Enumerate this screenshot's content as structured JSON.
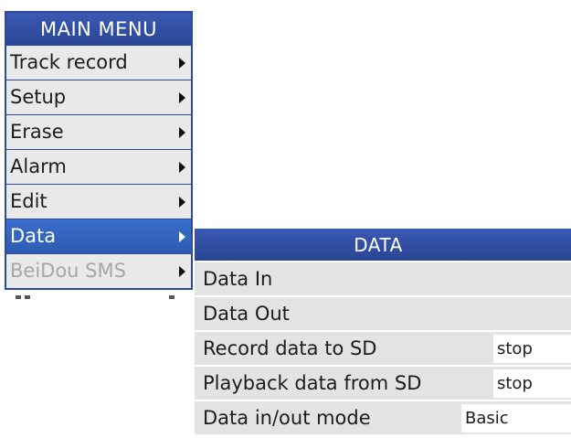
{
  "main_menu": {
    "title": "MAIN MENU",
    "items": [
      {
        "label": "Track record",
        "state": "normal"
      },
      {
        "label": "Setup",
        "state": "normal"
      },
      {
        "label": "Erase",
        "state": "normal"
      },
      {
        "label": "Alarm",
        "state": "normal"
      },
      {
        "label": "Edit",
        "state": "normal"
      },
      {
        "label": "Data",
        "state": "selected"
      },
      {
        "label": "BeiDou SMS",
        "state": "disabled"
      }
    ]
  },
  "data_menu": {
    "title": "DATA",
    "rows": [
      {
        "label": "Data In"
      },
      {
        "label": "Data Out"
      },
      {
        "label": "Record data to SD",
        "value": "stop"
      },
      {
        "label": "Playback data from SD",
        "value": "stop"
      },
      {
        "label": "Data in/out mode",
        "value": "Basic"
      }
    ]
  },
  "colors": {
    "menu_title_blue": "#2f4a9a",
    "selected_blue": "#2d5bb2",
    "item_grey": "#e9e9e9",
    "disabled_text": "#a7a7a7"
  }
}
